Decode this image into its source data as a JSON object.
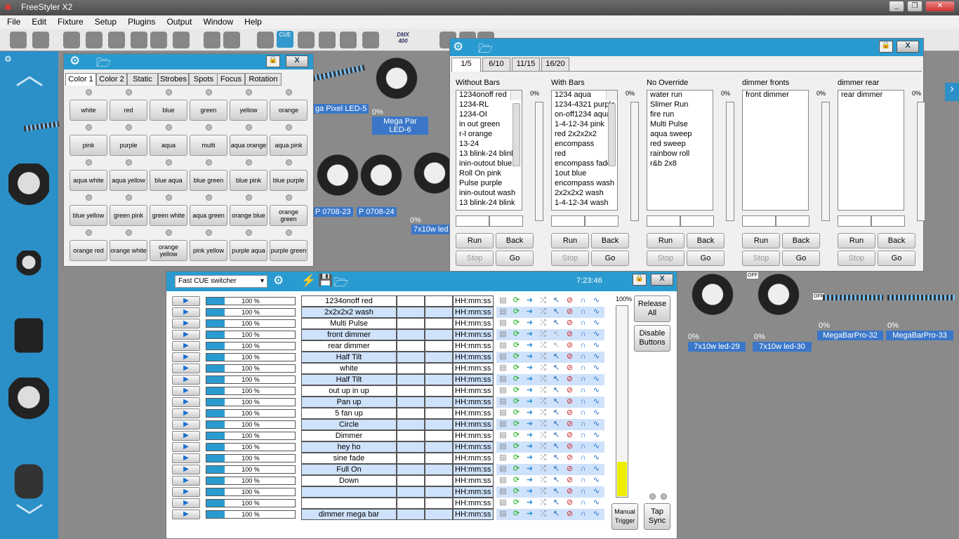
{
  "app": {
    "title": "FreeStyler X2",
    "window_buttons": [
      "_",
      "❐",
      "✕"
    ]
  },
  "menu": [
    "File",
    "Edit",
    "Fixture",
    "Setup",
    "Plugins",
    "Output",
    "Window",
    "Help"
  ],
  "toolbar": {
    "dmx_label": "DMX 400",
    "cue_label": "CUE"
  },
  "stage": {
    "fixtures": [
      {
        "label": "ga Pixel LED-5",
        "pct": ""
      },
      {
        "label": "Mega Par LED-6",
        "pct": "0%"
      },
      {
        "label": "P 0708-23",
        "pct": ""
      },
      {
        "label": "P 0708-24",
        "pct": ""
      },
      {
        "label": "7x10w led",
        "pct": "0%"
      },
      {
        "label": "7x10w led-29",
        "pct": "0%"
      },
      {
        "label": "7x10w led-30",
        "pct": "0%"
      },
      {
        "label": "MegaBarPro-32",
        "pct": "0%"
      },
      {
        "label": "MegaBarPro-33",
        "pct": "0%"
      }
    ],
    "off_label": "OFF"
  },
  "color_panel": {
    "tabs": [
      "Color 1",
      "Color 2",
      "Static",
      "Strobes",
      "Spots",
      "Focus",
      "Rotation"
    ],
    "active_tab": "Color 1",
    "buttons": [
      "white",
      "red",
      "blue",
      "green",
      "yellow",
      "orange",
      "pink",
      "purple",
      "aqua",
      "multi",
      "aqua orange",
      "aqua pink",
      "aqua white",
      "aqua yellow",
      "blue aqua",
      "blue green",
      "blue pink",
      "blue purple",
      "blue yellow",
      "green pink",
      "green white",
      "aqua green",
      "orange blue",
      "orange green",
      "orange red",
      "orange white",
      "orange yellow",
      "pink yellow",
      "purple aqua",
      "purple green"
    ]
  },
  "override_panel": {
    "tabs": [
      "1/5",
      "6/10",
      "11/15",
      "16/20"
    ],
    "active_tab": "1/5",
    "groups": [
      {
        "title": "Without Bars",
        "pct": "0%",
        "items": [
          "1234onoff red",
          "1234-RL",
          "1234-OI",
          "in out green",
          "r-l orange",
          "13-24",
          "13 blink-24 blink",
          "inin-outout blue",
          "Roll On pink",
          "Pulse purple",
          "inin-outout wash",
          "13 blink-24 blink"
        ],
        "scroll": true
      },
      {
        "title": "With Bars",
        "pct": "0%",
        "items": [
          "1234 aqua",
          "1234-4321 purple",
          "on-off1234 aqua",
          "1-4-12-34 pink",
          "red 2x2x2x2",
          "encompass",
          "red",
          "encompass fade",
          "1out blue",
          "encompass wash",
          "2x2x2x2 wash",
          "1-4-12-34 wash"
        ],
        "scroll": true
      },
      {
        "title": "No Override",
        "pct": "0%",
        "items": [
          "water run",
          "Slimer Run",
          "fire run",
          "Multi Pulse",
          "aqua sweep",
          "red sweep",
          "rainbow roll",
          "r&b 2x8"
        ],
        "scroll": false
      },
      {
        "title": "dimmer fronts",
        "pct": "0%",
        "items": [
          "front dimmer"
        ],
        "scroll": false
      },
      {
        "title": "dimmer rear",
        "pct": "0%",
        "items": [
          "rear dimmer"
        ],
        "scroll": false
      }
    ],
    "buttons": {
      "run": "Run",
      "back": "Back",
      "stop": "Stop",
      "go": "Go"
    }
  },
  "cue_panel": {
    "mode_select": "Fast CUE switcher",
    "clock": "7:23:46",
    "master_pct": "100%",
    "release_all": "Release All",
    "disable_buttons": "Disable Buttons",
    "manual_trigger": "Manual Trigger",
    "tap_sync": "Tap Sync",
    "master_level": 0.18,
    "rows": [
      {
        "pct": "100 %",
        "name": "1234onoff red",
        "time": "HH:mm:ss"
      },
      {
        "pct": "100 %",
        "name": "2x2x2x2 wash",
        "time": "HH:mm:ss"
      },
      {
        "pct": "100 %",
        "name": "Multi Pulse",
        "time": "HH:mm:ss"
      },
      {
        "pct": "100 %",
        "name": "front dimmer",
        "time": "HH:mm:ss"
      },
      {
        "pct": "100 %",
        "name": "rear dimmer",
        "time": "HH:mm:ss"
      },
      {
        "pct": "100 %",
        "name": "Half Tilt",
        "time": "HH:mm:ss"
      },
      {
        "pct": "100 %",
        "name": "white",
        "time": "HH:mm:ss"
      },
      {
        "pct": "100 %",
        "name": "Half Tilt",
        "time": "HH:mm:ss"
      },
      {
        "pct": "100 %",
        "name": "out up in up",
        "time": "HH:mm:ss"
      },
      {
        "pct": "100 %",
        "name": "Pan up",
        "time": "HH:mm:ss"
      },
      {
        "pct": "100 %",
        "name": "5 fan up",
        "time": "HH:mm:ss"
      },
      {
        "pct": "100 %",
        "name": "Circle",
        "time": "HH:mm:ss"
      },
      {
        "pct": "100 %",
        "name": "Dimmer",
        "time": "HH:mm:ss"
      },
      {
        "pct": "100 %",
        "name": "hey ho",
        "time": "HH:mm:ss"
      },
      {
        "pct": "100 %",
        "name": "sine fade",
        "time": "HH:mm:ss"
      },
      {
        "pct": "100 %",
        "name": "Full On",
        "time": "HH:mm:ss"
      },
      {
        "pct": "100 %",
        "name": "Down",
        "time": "HH:mm:ss"
      },
      {
        "pct": "100 %",
        "name": "",
        "time": "HH:mm:ss"
      },
      {
        "pct": "100 %",
        "name": "",
        "time": "HH:mm:ss"
      },
      {
        "pct": "100 %",
        "name": "dimmer mega bar",
        "time": "HH:mm:ss"
      }
    ]
  },
  "colors": {
    "accent": "#2a9bd0",
    "row_alt": "#cfe2fb",
    "fixture_label": "#3b77c9"
  }
}
